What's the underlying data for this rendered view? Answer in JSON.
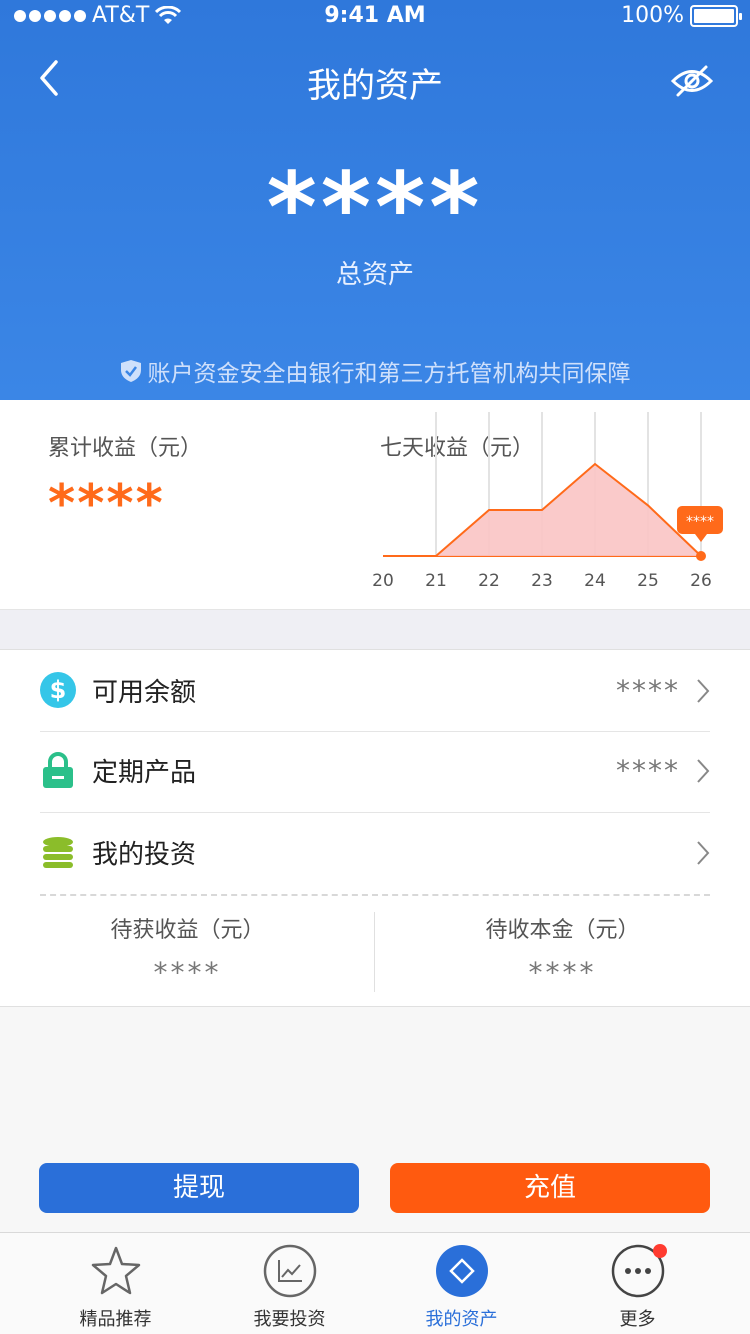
{
  "status_bar": {
    "carrier": "AT&T",
    "time": "9:41 AM",
    "battery": "100%"
  },
  "header": {
    "title": "我的资产",
    "total_value": "****",
    "total_label": "总资产",
    "safety_note": "账户资金安全由银行和第三方托管机构共同保障"
  },
  "earnings": {
    "cumulative_label": "累计收益（元）",
    "cumulative_value": "****",
    "seven_day_label": "七天收益（元）"
  },
  "chart_data": {
    "type": "area",
    "x": [
      "20",
      "21",
      "22",
      "23",
      "24",
      "25",
      "26"
    ],
    "values": [
      0,
      0,
      1,
      1,
      2,
      1.1,
      0
    ],
    "highlight_label": "****",
    "colors": {
      "line": "#ff6a1a",
      "fill": "#f9c4c4"
    }
  },
  "list": {
    "available": {
      "label": "可用余额",
      "value": "****"
    },
    "fixed": {
      "label": "定期产品",
      "value": "****"
    },
    "investment": {
      "label": "我的投资"
    },
    "pending_income": {
      "label": "待获收益（元）",
      "value": "****"
    },
    "pending_principal": {
      "label": "待收本金（元）",
      "value": "****"
    }
  },
  "buttons": {
    "withdraw": "提现",
    "recharge": "充值"
  },
  "tabs": [
    {
      "label": "精品推荐",
      "icon": "star-icon"
    },
    {
      "label": "我要投资",
      "icon": "chart-icon"
    },
    {
      "label": "我的资产",
      "icon": "diamond-icon",
      "active": true
    },
    {
      "label": "更多",
      "icon": "more-icon"
    }
  ],
  "colors": {
    "primary": "#2a6fd9",
    "accent": "#ff5a0f"
  }
}
